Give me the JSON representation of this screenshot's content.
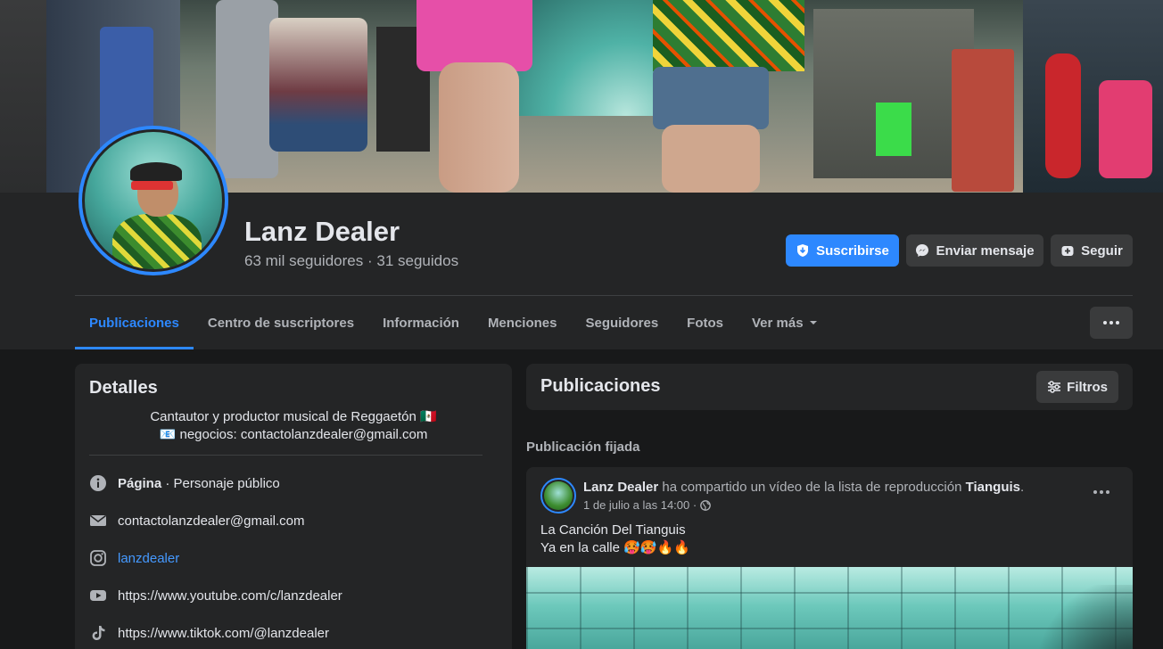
{
  "profile": {
    "name": "Lanz Dealer",
    "followers": "63 mil seguidores",
    "following": "31 seguidos",
    "separator": "·"
  },
  "actions": {
    "subscribe": "Suscribirse",
    "message": "Enviar mensaje",
    "follow": "Seguir"
  },
  "tabs": [
    {
      "label": "Publicaciones",
      "active": true
    },
    {
      "label": "Centro de suscriptores"
    },
    {
      "label": "Información"
    },
    {
      "label": "Menciones"
    },
    {
      "label": "Seguidores"
    },
    {
      "label": "Fotos"
    },
    {
      "label": "Ver más"
    }
  ],
  "details": {
    "title": "Detalles",
    "bio_line1": "Cantautor y productor musical de Reggaetón 🇲🇽",
    "bio_line2": "📧 negocios: contactolanzdealer@gmail.com",
    "page_label": "Página",
    "page_category": " · Personaje público",
    "email": "contactolanzdealer@gmail.com",
    "instagram": "lanzdealer",
    "youtube": "https://www.youtube.com/c/lanzdealer",
    "tiktok": "https://www.tiktok.com/@lanzdealer"
  },
  "posts": {
    "title": "Publicaciones",
    "filters": "Filtros",
    "pinned_label": "Publicación fijada",
    "pinned": {
      "author": "Lanz Dealer",
      "action": " ha compartido un vídeo de la lista de reproducción ",
      "playlist": "Tianguis",
      "period": ".",
      "time": "1 de julio a las 14:00 ·",
      "line1": "La Canción Del Tianguis",
      "line2": "Ya en la calle 🥵🥵🔥🔥"
    }
  },
  "colors": {
    "accent": "#2d88ff",
    "background": "#18191a",
    "card": "#242526",
    "button": "#3a3b3c"
  }
}
